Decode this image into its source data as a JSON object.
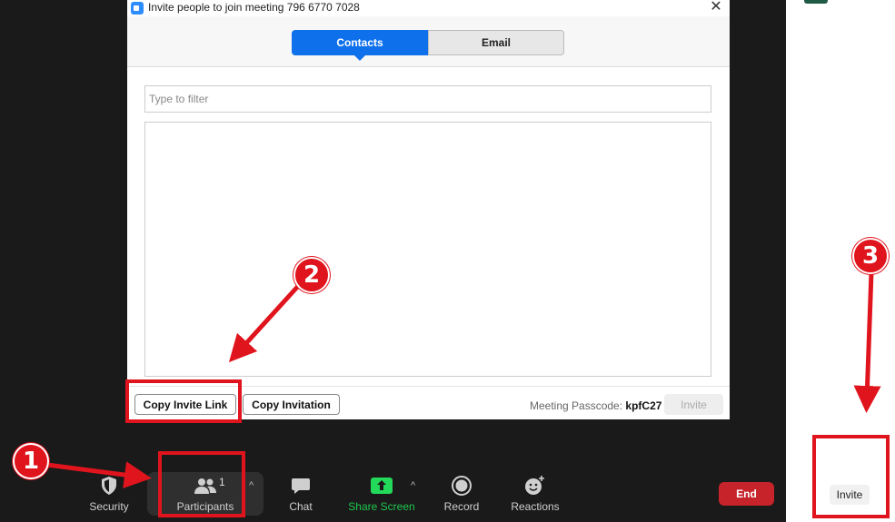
{
  "dialog": {
    "title": "Invite people to join meeting 796 6770 7028",
    "close_glyph": "✕",
    "tabs": [
      {
        "label": "Contacts",
        "active": true
      },
      {
        "label": "Email",
        "active": false
      }
    ],
    "filter_placeholder": "Type to filter",
    "footer": {
      "copy_link_label": "Copy Invite Link",
      "copy_invitation_label": "Copy Invitation",
      "passcode_label": "Meeting Passcode:",
      "passcode_value": "kpfC27",
      "invite_label": "Invite"
    }
  },
  "toolbar": {
    "security_label": "Security",
    "participants_label": "Participants",
    "participants_count": "1",
    "chat_label": "Chat",
    "share_screen_label": "Share Screen",
    "record_label": "Record",
    "reactions_label": "Reactions",
    "end_label": "End",
    "caret_glyph": "^"
  },
  "side_panel": {
    "invite_label": "Invite"
  },
  "annotations": {
    "markers": [
      "1",
      "2",
      "3"
    ],
    "color": "#e0141d"
  },
  "colors": {
    "accent": "#0e71eb",
    "end_red": "#c6232b",
    "share_green": "#23d959",
    "share_label_green": "#1fc84f"
  }
}
